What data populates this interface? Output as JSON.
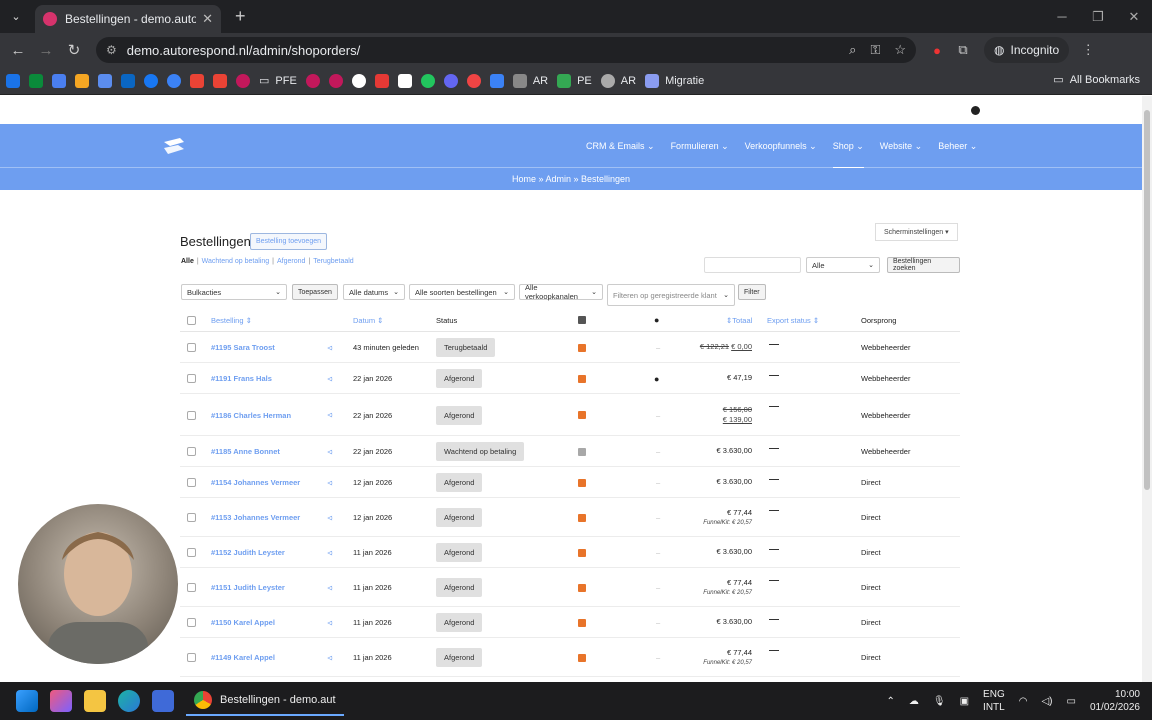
{
  "browser": {
    "tab_title": "Bestellingen - demo.autorespond",
    "url": "demo.autorespond.nl/admin/shoporders/",
    "incognito_label": "Incognito",
    "bookmarks": [
      "PFE",
      "AR",
      "PE",
      "AR",
      "Migratie"
    ],
    "all_bookmarks_label": "All Bookmarks"
  },
  "site": {
    "menu": [
      "CRM & Emails",
      "Formulieren",
      "Verkoopfunnels",
      "Shop",
      "Website",
      "Beheer"
    ],
    "active_menu": "Shop",
    "breadcrumb": "Home » Admin » Bestellingen"
  },
  "page": {
    "title": "Bestellingen",
    "add_button": "Bestelling toevoegen",
    "screen_settings": "Scherminstellingen ▾",
    "filter_links": {
      "all": "Alle",
      "waiting": "Wachtend op betaling",
      "completed": "Afgerond",
      "refunded": "Terugbetaald"
    },
    "search_select": "Alle",
    "search_button": "Bestellingen zoeken",
    "bulk_actions": "Bulkacties",
    "apply_button": "Toepassen",
    "dates_select": "Alle datums",
    "types_select": "Alle soorten bestellingen",
    "channels_select": "Alle verkoopkanalen",
    "customer_filter_placeholder": "Filteren op geregistreerde klant",
    "filter_button": "Filter"
  },
  "table": {
    "headers": {
      "order": "Bestelling",
      "date": "Datum",
      "status": "Status",
      "total": "Totaal",
      "export_status": "Export status",
      "origin": "Oorsprong"
    },
    "rows": [
      {
        "order": "#1195 Sara Troost",
        "date": "43 minuten geleden",
        "status": "Terugbetaald",
        "icon": "orange",
        "col2": "–",
        "total_old": "€ 122,21",
        "total": "€ 0,00",
        "funnelkit": "",
        "origin": "Webbeheerder"
      },
      {
        "order": "#1191 Frans Hals",
        "date": "22 jan 2026",
        "status": "Afgerond",
        "icon": "orange",
        "col2": "user",
        "total_old": "",
        "total": "€ 47,19",
        "funnelkit": "",
        "origin": "Webbeheerder"
      },
      {
        "order": "#1186 Charles Herman",
        "date": "22 jan 2026",
        "status": "Afgerond",
        "icon": "orange",
        "col2": "–",
        "total_old": "€ 156,00",
        "total": "€ 139,00",
        "funnelkit": "",
        "origin": "Webbeheerder"
      },
      {
        "order": "#1185 Anne Bonnet",
        "date": "22 jan 2026",
        "status": "Wachtend op betaling",
        "icon": "grey",
        "col2": "–",
        "total_old": "",
        "total": "€ 3.630,00",
        "funnelkit": "",
        "origin": "Webbeheerder"
      },
      {
        "order": "#1154 Johannes Vermeer",
        "date": "12 jan 2026",
        "status": "Afgerond",
        "icon": "orange",
        "col2": "–",
        "total_old": "",
        "total": "€ 3.630,00",
        "funnelkit": "",
        "origin": "Direct"
      },
      {
        "order": "#1153 Johannes Vermeer",
        "date": "12 jan 2026",
        "status": "Afgerond",
        "icon": "orange",
        "col2": "–",
        "total_old": "",
        "total": "€ 77,44",
        "funnelkit": "FunnelKit: € 20,57",
        "origin": "Direct"
      },
      {
        "order": "#1152 Judith Leyster",
        "date": "11 jan 2026",
        "status": "Afgerond",
        "icon": "orange",
        "col2": "–",
        "total_old": "",
        "total": "€ 3.630,00",
        "funnelkit": "",
        "origin": "Direct"
      },
      {
        "order": "#1151 Judith Leyster",
        "date": "11 jan 2026",
        "status": "Afgerond",
        "icon": "orange",
        "col2": "–",
        "total_old": "",
        "total": "€ 77,44",
        "funnelkit": "FunnelKit: € 20,57",
        "origin": "Direct"
      },
      {
        "order": "#1150 Karel Appel",
        "date": "11 jan 2026",
        "status": "Afgerond",
        "icon": "orange",
        "col2": "–",
        "total_old": "",
        "total": "€ 3.630,00",
        "funnelkit": "",
        "origin": "Direct"
      },
      {
        "order": "#1149 Karel Appel",
        "date": "11 jan 2026",
        "status": "Afgerond",
        "icon": "orange",
        "col2": "–",
        "total_old": "",
        "total": "€ 77,44",
        "funnelkit": "FunnelKit: € 20,57",
        "origin": "Direct"
      }
    ]
  },
  "taskbar": {
    "app_label": "Bestellingen - demo.aut",
    "lang": "ENG",
    "layout": "INTL",
    "time": "10:00",
    "date": "01/02/2026"
  },
  "colors": {
    "accent": "#6e9ef0",
    "hero": "#6e9ef0",
    "status_icon": "#e8742a"
  }
}
